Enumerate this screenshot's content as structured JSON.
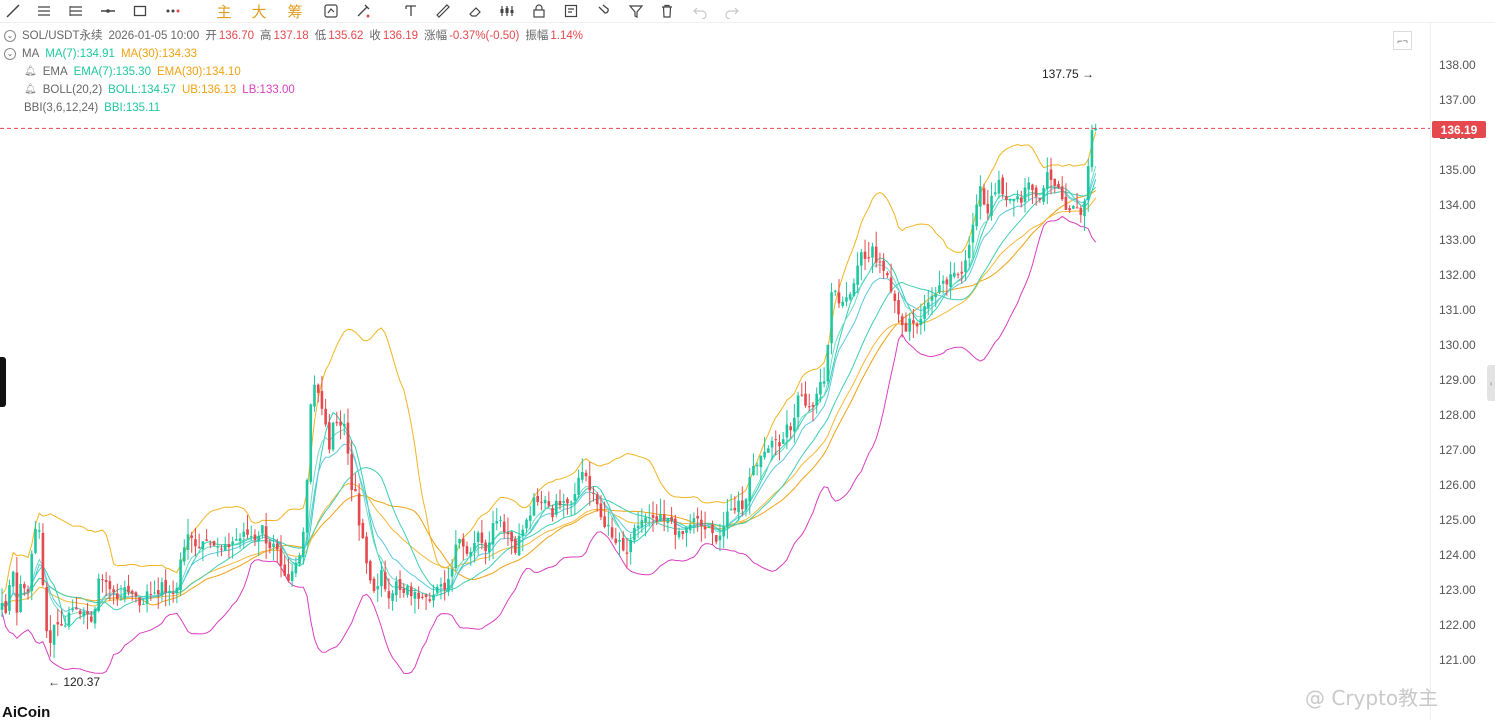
{
  "toolbar": {
    "tools": [
      "line-tool",
      "multi-line-tool",
      "parallel-tool",
      "horizontal-line-tool",
      "rectangle-tool",
      "more-tools",
      "main-button",
      "big-button",
      "chips-button",
      "replace-tool",
      "pen-tool",
      "text-tool",
      "ruler-tool",
      "eraser-tool",
      "pattern-tool",
      "lock-tool",
      "note-tool",
      "magnet-tool",
      "filter-tool",
      "delete-tool",
      "undo-tool",
      "redo-tool"
    ],
    "main_label": "主",
    "big_label": "大",
    "chips_label": "筹"
  },
  "legend": {
    "symbol": "SOL/USDT永续",
    "datetime": "2026-01-05 10:00",
    "open_label": "开",
    "open": "136.70",
    "high_label": "高",
    "high": "137.18",
    "low_label": "低",
    "low": "135.62",
    "close_label": "收",
    "close": "136.19",
    "change_label": "涨幅",
    "change": "-0.37%(-0.50)",
    "amp_label": "振幅",
    "amp": "1.14%",
    "ma_name": "MA",
    "ma7": "MA(7):134.91",
    "ma30": "MA(30):134.33",
    "ema_name": "EMA",
    "ema7": "EMA(7):135.30",
    "ema30": "EMA(30):134.10",
    "boll_name": "BOLL(20,2)",
    "boll": "BOLL:134.57",
    "ub": "UB:136.13",
    "lb": "LB:133.00",
    "bbi_name": "BBI(3,6,12,24)",
    "bbi": "BBI:135.11"
  },
  "axis": {
    "ticks": [
      "138.00",
      "137.00",
      "136.00",
      "135.00",
      "134.00",
      "133.00",
      "132.00",
      "131.00",
      "130.00",
      "129.00",
      "128.00",
      "127.00",
      "126.00",
      "125.00",
      "124.00",
      "123.00",
      "122.00",
      "121.00"
    ],
    "last_price": "136.19"
  },
  "logo": "AiCoin",
  "watermark": "@ Crypto教主",
  "colors": {
    "up": "#1fc7a0",
    "down": "#e5484d",
    "ma7": "#2fd0b0",
    "ma30": "#f0a212",
    "boll_ub": "#f0b521",
    "boll_lb": "#d93fbf",
    "last_line": "#e5484d"
  },
  "chart_data": {
    "type": "candlestick",
    "symbol": "SOL/USDT永续",
    "ylim": [
      120.5,
      138.3
    ],
    "max_marker": {
      "label": "137.75",
      "value": 137.75
    },
    "min_marker": {
      "label": "120.37",
      "value": 120.37
    },
    "last_price": 136.19,
    "close_path": [
      [
        0,
        122.8
      ],
      [
        6,
        122.3
      ],
      [
        12,
        124.0
      ],
      [
        18,
        122.0
      ],
      [
        22,
        123.8
      ],
      [
        27,
        122.5
      ],
      [
        33,
        124.4
      ],
      [
        37,
        125.0
      ],
      [
        40,
        124.7
      ],
      [
        43,
        123.0
      ],
      [
        46,
        121.8
      ],
      [
        50,
        121.6
      ],
      [
        56,
        122.2
      ],
      [
        62,
        121.9
      ],
      [
        70,
        122.4
      ],
      [
        78,
        122.6
      ],
      [
        86,
        122.1
      ],
      [
        94,
        122.3
      ],
      [
        100,
        123.4
      ],
      [
        104,
        123.4
      ],
      [
        110,
        123.0
      ],
      [
        116,
        122.8
      ],
      [
        124,
        122.9
      ],
      [
        132,
        123.0
      ],
      [
        140,
        122.6
      ],
      [
        148,
        122.9
      ],
      [
        156,
        123.0
      ],
      [
        164,
        123.1
      ],
      [
        170,
        122.8
      ],
      [
        176,
        123.0
      ],
      [
        182,
        124.1
      ],
      [
        188,
        124.5
      ],
      [
        194,
        124.4
      ],
      [
        200,
        124.3
      ],
      [
        208,
        124.6
      ],
      [
        216,
        124.2
      ],
      [
        224,
        124.1
      ],
      [
        232,
        124.4
      ],
      [
        240,
        124.5
      ],
      [
        248,
        124.6
      ],
      [
        256,
        124.5
      ],
      [
        262,
        124.8
      ],
      [
        268,
        124.3
      ],
      [
        276,
        124.2
      ],
      [
        282,
        123.4
      ],
      [
        288,
        123.1
      ],
      [
        294,
        123.6
      ],
      [
        300,
        124.0
      ],
      [
        306,
        125.5
      ],
      [
        310,
        128.2
      ],
      [
        314,
        129.0
      ],
      [
        318,
        128.7
      ],
      [
        322,
        128.1
      ],
      [
        326,
        127.6
      ],
      [
        330,
        127.0
      ],
      [
        334,
        127.8
      ],
      [
        338,
        128.0
      ],
      [
        342,
        127.6
      ],
      [
        346,
        127.8
      ],
      [
        350,
        126.0
      ],
      [
        354,
        126.0
      ],
      [
        358,
        125.0
      ],
      [
        362,
        124.5
      ],
      [
        366,
        123.8
      ],
      [
        370,
        123.3
      ],
      [
        374,
        123.1
      ],
      [
        378,
        123.0
      ],
      [
        382,
        123.5
      ],
      [
        386,
        123.0
      ],
      [
        390,
        122.9
      ],
      [
        396,
        123.2
      ],
      [
        402,
        122.8
      ],
      [
        408,
        123.0
      ],
      [
        416,
        122.8
      ],
      [
        424,
        123.0
      ],
      [
        432,
        122.8
      ],
      [
        438,
        123.0
      ],
      [
        444,
        123.1
      ],
      [
        450,
        123.4
      ],
      [
        456,
        124.4
      ],
      [
        462,
        124.5
      ],
      [
        468,
        124.0
      ],
      [
        474,
        124.4
      ],
      [
        480,
        124.6
      ],
      [
        486,
        124.2
      ],
      [
        492,
        124.8
      ],
      [
        498,
        125.2
      ],
      [
        504,
        124.8
      ],
      [
        510,
        124.5
      ],
      [
        516,
        124.2
      ],
      [
        522,
        124.7
      ],
      [
        528,
        125.0
      ],
      [
        534,
        125.5
      ],
      [
        540,
        125.4
      ],
      [
        546,
        125.7
      ],
      [
        552,
        125.2
      ],
      [
        558,
        125.5
      ],
      [
        564,
        125.7
      ],
      [
        570,
        125.5
      ],
      [
        576,
        126.0
      ],
      [
        582,
        126.4
      ],
      [
        586,
        126.3
      ],
      [
        590,
        125.8
      ],
      [
        594,
        125.6
      ],
      [
        598,
        125.4
      ],
      [
        602,
        125.0
      ],
      [
        606,
        124.9
      ],
      [
        610,
        124.6
      ],
      [
        614,
        124.3
      ],
      [
        618,
        124.4
      ],
      [
        622,
        124.1
      ],
      [
        626,
        124.0
      ],
      [
        630,
        124.2
      ],
      [
        636,
        124.8
      ],
      [
        642,
        125.0
      ],
      [
        648,
        125.0
      ],
      [
        654,
        124.9
      ],
      [
        660,
        125.0
      ],
      [
        666,
        124.9
      ],
      [
        672,
        125.0
      ],
      [
        678,
        124.5
      ],
      [
        684,
        124.6
      ],
      [
        690,
        124.9
      ],
      [
        696,
        125.0
      ],
      [
        702,
        124.8
      ],
      [
        708,
        124.7
      ],
      [
        714,
        124.5
      ],
      [
        720,
        124.6
      ],
      [
        726,
        125.0
      ],
      [
        732,
        125.3
      ],
      [
        738,
        125.5
      ],
      [
        744,
        125.4
      ],
      [
        748,
        126.0
      ],
      [
        752,
        126.5
      ],
      [
        756,
        126.8
      ],
      [
        760,
        126.6
      ],
      [
        764,
        126.9
      ],
      [
        768,
        127.2
      ],
      [
        772,
        127.3
      ],
      [
        776,
        127.4
      ],
      [
        780,
        127.0
      ],
      [
        784,
        127.5
      ],
      [
        788,
        127.7
      ],
      [
        792,
        127.6
      ],
      [
        796,
        127.9
      ],
      [
        800,
        129.1
      ],
      [
        804,
        128.0
      ],
      [
        808,
        128.4
      ],
      [
        812,
        128.2
      ],
      [
        816,
        128.6
      ],
      [
        820,
        128.8
      ],
      [
        824,
        128.9
      ],
      [
        828,
        130.2
      ],
      [
        832,
        131.8
      ],
      [
        836,
        131.5
      ],
      [
        840,
        131.2
      ],
      [
        844,
        131.3
      ],
      [
        848,
        131.4
      ],
      [
        852,
        131.6
      ],
      [
        856,
        132.3
      ],
      [
        860,
        132.6
      ],
      [
        864,
        132.5
      ],
      [
        868,
        132.4
      ],
      [
        872,
        132.7
      ],
      [
        876,
        132.5
      ],
      [
        880,
        132.4
      ],
      [
        884,
        132.2
      ],
      [
        888,
        132.0
      ],
      [
        892,
        131.6
      ],
      [
        896,
        131.3
      ],
      [
        900,
        130.5
      ],
      [
        904,
        130.4
      ],
      [
        908,
        130.7
      ],
      [
        912,
        130.8
      ],
      [
        916,
        130.5
      ],
      [
        920,
        130.8
      ],
      [
        924,
        131.0
      ],
      [
        928,
        131.2
      ],
      [
        932,
        131.5
      ],
      [
        936,
        131.4
      ],
      [
        940,
        131.6
      ],
      [
        944,
        131.7
      ],
      [
        948,
        131.8
      ],
      [
        952,
        131.9
      ],
      [
        956,
        132.0
      ],
      [
        960,
        132.1
      ],
      [
        964,
        132.3
      ],
      [
        968,
        132.9
      ],
      [
        972,
        133.2
      ],
      [
        976,
        133.9
      ],
      [
        980,
        134.4
      ],
      [
        984,
        134.1
      ],
      [
        988,
        133.8
      ],
      [
        992,
        134.4
      ],
      [
        996,
        134.5
      ],
      [
        1000,
        134.6
      ],
      [
        1004,
        134.1
      ],
      [
        1008,
        134.0
      ],
      [
        1012,
        134.2
      ],
      [
        1016,
        134.3
      ],
      [
        1020,
        134.1
      ],
      [
        1024,
        134.4
      ],
      [
        1028,
        134.5
      ],
      [
        1032,
        134.4
      ],
      [
        1036,
        134.3
      ],
      [
        1040,
        134.2
      ],
      [
        1044,
        134.5
      ],
      [
        1048,
        135.0
      ],
      [
        1052,
        134.8
      ],
      [
        1056,
        134.5
      ],
      [
        1060,
        134.3
      ],
      [
        1064,
        133.9
      ],
      [
        1068,
        133.8
      ],
      [
        1072,
        133.9
      ],
      [
        1076,
        134.0
      ],
      [
        1080,
        133.8
      ],
      [
        1084,
        134.1
      ],
      [
        1088,
        135.1
      ],
      [
        1092,
        136.0
      ],
      [
        1096,
        136.19
      ]
    ],
    "series": [
      {
        "name": "MA(7)",
        "latest": 134.91
      },
      {
        "name": "MA(30)",
        "latest": 134.33
      },
      {
        "name": "EMA(7)",
        "latest": 135.3
      },
      {
        "name": "EMA(30)",
        "latest": 134.1
      },
      {
        "name": "BOLL",
        "latest": 134.57
      },
      {
        "name": "UB",
        "latest": 136.13
      },
      {
        "name": "LB",
        "latest": 133.0
      },
      {
        "name": "BBI",
        "latest": 135.11
      }
    ]
  }
}
